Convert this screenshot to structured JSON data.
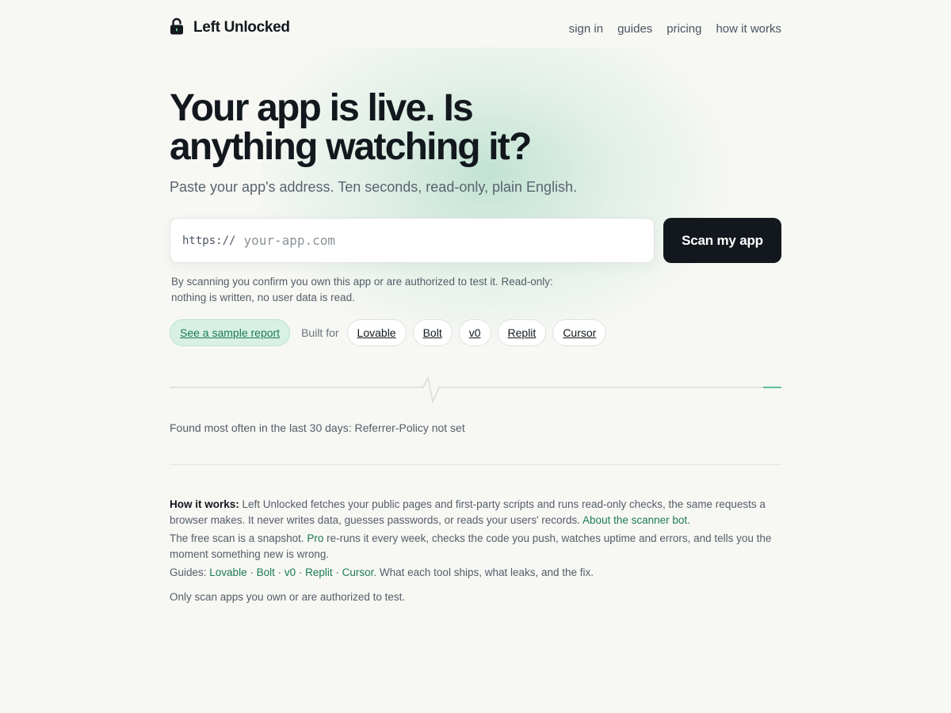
{
  "brand": {
    "name": "Left Unlocked",
    "icon": "unlocked-padlock-icon"
  },
  "nav": [
    {
      "label": "sign in"
    },
    {
      "label": "guides"
    },
    {
      "label": "pricing"
    },
    {
      "label": "how it works"
    }
  ],
  "hero": {
    "title": "Your app is live. Is anything watching it?",
    "subtitle": "Paste your app's address. Ten seconds, read-only, plain English."
  },
  "scan": {
    "prefix": "https://",
    "placeholder": "your-app.com",
    "value": "",
    "button_label": "Scan my app",
    "consent": "By scanning you confirm you own this app or are authorized to test it. Read-only: nothing is written, no user data is read."
  },
  "chips": {
    "sample_label": "See a sample report",
    "built_for_label": "Built for",
    "tools": [
      "Lovable",
      "Bolt",
      "v0",
      "Replit",
      "Cursor"
    ]
  },
  "finding": {
    "text": "Found most often in the last 30 days: Referrer-Policy not set"
  },
  "how": {
    "heading": "How it works:",
    "p1_text": " Left Unlocked fetches your public pages and first-party scripts and runs read-only checks, the same requests a browser makes. It never writes data, guesses passwords, or reads your users' records. ",
    "p1_link": "About the scanner bot.",
    "p2_before": "The free scan is a snapshot. ",
    "p2_link": "Pro",
    "p2_after": " re-runs it every week, checks the code you push, watches uptime and errors, and tells you the moment something new is wrong.",
    "guides_label": "Guides: ",
    "guides": [
      "Lovable",
      "Bolt",
      "v0",
      "Replit",
      "Cursor"
    ],
    "guides_sep": " · ",
    "guides_after": ". What each tool ships, what leaks, and the fix.",
    "note": "Only scan apps you own or are authorized to test."
  },
  "colors": {
    "accent": "#1b7a58",
    "dark": "#12181d",
    "background": "#f7f7f4",
    "chip_green": "#d8f0e5"
  }
}
